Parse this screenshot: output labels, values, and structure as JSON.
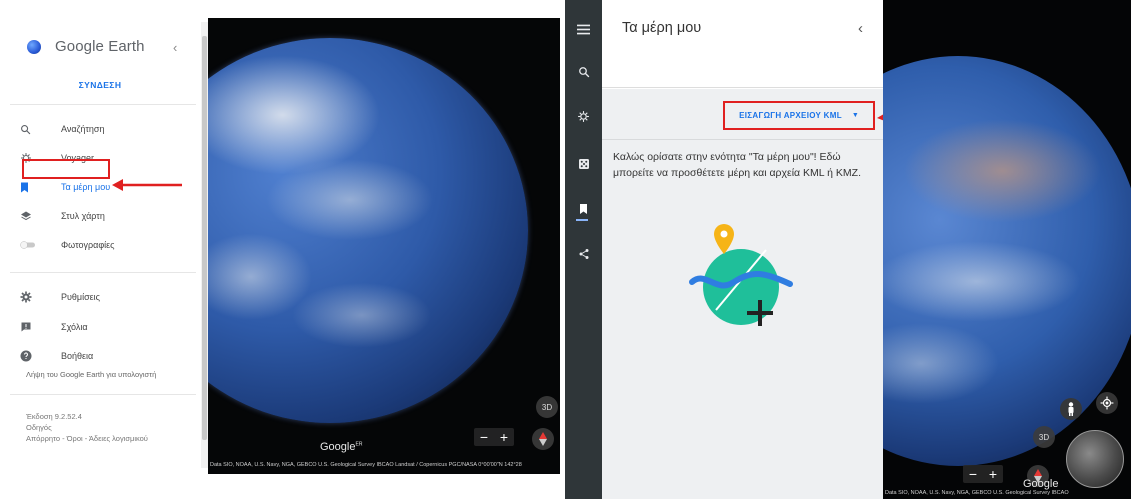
{
  "left": {
    "brand": {
      "name": "Google Earth",
      "collapse": "‹"
    },
    "signin_label": "ΣΥΝΔΕΣΗ",
    "menu": [
      {
        "label": "Αναζήτηση",
        "icon": "search-icon"
      },
      {
        "label": "Voyager",
        "icon": "voyager-icon"
      },
      {
        "label": "Τα μέρη μου",
        "icon": "bookmark-icon",
        "active": true
      },
      {
        "label": "Στυλ χάρτη",
        "icon": "layers-icon"
      },
      {
        "label": "Φωτογραφίες",
        "icon": "toggle-icon"
      },
      {
        "label": "Ρυθμίσεις",
        "icon": "gear-icon"
      },
      {
        "label": "Σχόλια",
        "icon": "feedback-icon"
      },
      {
        "label": "Βοήθεια",
        "icon": "help-icon"
      }
    ],
    "download_link": "Λήψη του Google Earth για υπολογιστή",
    "version_lines": [
      "Έκδοση 9.2.52.4",
      "Οδηγός",
      "Απόρρητο - Όροι - Άδειες λογισμικού"
    ],
    "map": {
      "view_3d": "3D",
      "zoom_out": "−",
      "zoom_in": "+",
      "watermark": "Google",
      "watermark_sup": "ER",
      "attribution": "Data SIO, NOAA, U.S. Navy, NGA, GEBCO U.S. Geological Survey  IBCAO  Landsat / Copernicus  PGC/NASA    0°00'00\"N 142°28"
    }
  },
  "right": {
    "panel_title": "Τα μέρη μου",
    "panel_close": "‹",
    "import_kml_label": "ΕΙΣΑΓΩΓΗ ΑΡΧΕΙΟΥ KML",
    "import_kml_caret": "▼",
    "welcome_text": "Καλώς ορίσατε στην ενότητα \"Τα μέρη μου\"! Εδώ μπορείτε να προσθέτετε μέρη και αρχεία KML ή KMZ.",
    "map": {
      "view_3d": "3D",
      "zoom_out": "−",
      "zoom_in": "+",
      "watermark": "Google",
      "attribution": "Data SIO, NOAA, U.S. Navy, NGA, GEBCO  U.S. Geological Survey  IBCAO"
    }
  },
  "colors": {
    "accent": "#1a73e8",
    "highlight": "#e02020",
    "rail": "#2f3639",
    "panel_body": "#eef0f2"
  }
}
